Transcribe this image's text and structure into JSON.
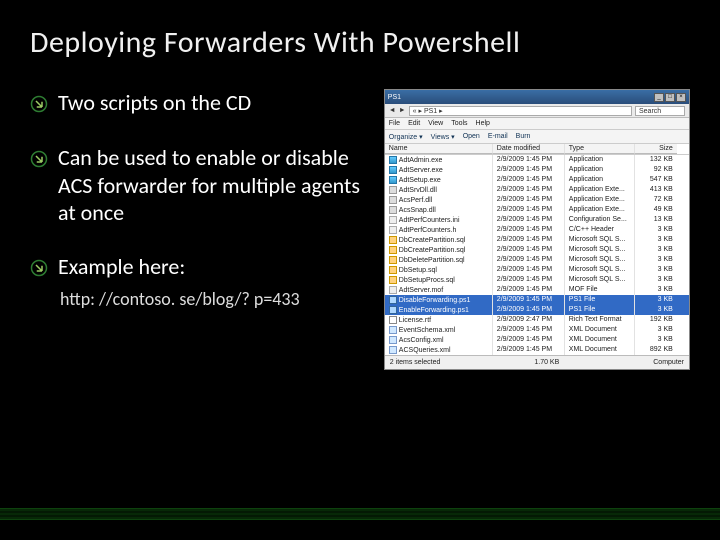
{
  "title": "Deploying Forwarders With Powershell",
  "bullets": [
    {
      "text": "Two scripts on the CD"
    },
    {
      "text": "Can be used to enable or disable ACS forwarder for multiple agents at once"
    },
    {
      "text": "Example here:"
    }
  ],
  "example_url": "http: //contoso. se/blog/? p=433",
  "explorer": {
    "window_title": "PS1",
    "address": "« ▸ PS1 ▸",
    "search_placeholder": "Search",
    "menu": [
      "File",
      "Edit",
      "View",
      "Tools",
      "Help"
    ],
    "toolbar": [
      "Organize ▾",
      "Views ▾",
      "Open",
      "E-mail",
      "Burn"
    ],
    "columns": [
      "Name",
      "Date modified",
      "Type",
      "Size"
    ],
    "rows": [
      {
        "icon": "app",
        "name": "AdtAdmin.exe",
        "date": "2/9/2009 1:45 PM",
        "type": "Application",
        "size": "132 KB"
      },
      {
        "icon": "app",
        "name": "AdtServer.exe",
        "date": "2/9/2009 1:45 PM",
        "type": "Application",
        "size": "92 KB"
      },
      {
        "icon": "app",
        "name": "AdtSetup.exe",
        "date": "2/9/2009 1:45 PM",
        "type": "Application",
        "size": "547 KB"
      },
      {
        "icon": "dll",
        "name": "AdtSrvDll.dll",
        "date": "2/9/2009 1:45 PM",
        "type": "Application Exte...",
        "size": "413 KB"
      },
      {
        "icon": "dll",
        "name": "AcsPerf.dll",
        "date": "2/9/2009 1:45 PM",
        "type": "Application Exte...",
        "size": "72 KB"
      },
      {
        "icon": "dll",
        "name": "AcsSnap.dll",
        "date": "2/9/2009 1:45 PM",
        "type": "Application Exte...",
        "size": "49 KB"
      },
      {
        "icon": "cfg",
        "name": "AdtPerfCounters.ini",
        "date": "2/9/2009 1:45 PM",
        "type": "Configuration Se...",
        "size": "13 KB"
      },
      {
        "icon": "cfg",
        "name": "AdtPerfCounters.h",
        "date": "2/9/2009 1:45 PM",
        "type": "C/C++ Header",
        "size": "3 KB"
      },
      {
        "icon": "sql",
        "name": "DbCreatePartition.sql",
        "date": "2/9/2009 1:45 PM",
        "type": "Microsoft SQL S...",
        "size": "3 KB"
      },
      {
        "icon": "sql",
        "name": "DbCreatePartition.sql",
        "date": "2/9/2009 1:45 PM",
        "type": "Microsoft SQL S...",
        "size": "3 KB"
      },
      {
        "icon": "sql",
        "name": "DbDeletePartition.sql",
        "date": "2/9/2009 1:45 PM",
        "type": "Microsoft SQL S...",
        "size": "3 KB"
      },
      {
        "icon": "sql",
        "name": "DbSetup.sql",
        "date": "2/9/2009 1:45 PM",
        "type": "Microsoft SQL S...",
        "size": "3 KB"
      },
      {
        "icon": "sql",
        "name": "DbSetupProcs.sql",
        "date": "2/9/2009 1:45 PM",
        "type": "Microsoft SQL S...",
        "size": "3 KB"
      },
      {
        "icon": "cfg",
        "name": "AdtServer.mof",
        "date": "2/9/2009 1:45 PM",
        "type": "MOF File",
        "size": "3 KB"
      },
      {
        "icon": "ps1",
        "name": "DisableForwarding.ps1",
        "date": "2/9/2009 1:45 PM",
        "type": "PS1 File",
        "size": "3 KB",
        "selected": true
      },
      {
        "icon": "ps1",
        "name": "EnableForwarding.ps1",
        "date": "2/9/2009 1:45 PM",
        "type": "PS1 File",
        "size": "3 KB",
        "selected": true
      },
      {
        "icon": "rtf",
        "name": "License.rtf",
        "date": "2/9/2009 2:47 PM",
        "type": "Rich Text Format",
        "size": "192 KB"
      },
      {
        "icon": "xml",
        "name": "EventSchema.xml",
        "date": "2/9/2009 1:45 PM",
        "type": "XML Document",
        "size": "3 KB"
      },
      {
        "icon": "xml",
        "name": "AcsConfig.xml",
        "date": "2/9/2009 1:45 PM",
        "type": "XML Document",
        "size": "3 KB"
      },
      {
        "icon": "xml",
        "name": "ACSQueries.xml",
        "date": "2/9/2009 1:45 PM",
        "type": "XML Document",
        "size": "892 KB"
      }
    ],
    "status_left": "2 items selected",
    "status_mid": "1.70 KB",
    "status_right": "Computer"
  }
}
